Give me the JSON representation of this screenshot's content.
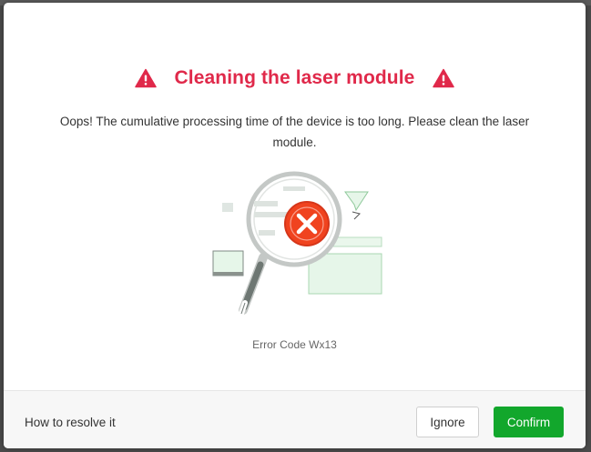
{
  "dialog": {
    "title": "Cleaning the laser module",
    "message": "Oops! The cumulative processing time of the device is too long. Please clean the laser module.",
    "error_code": "Error Code Wx13",
    "title_icon": "warning-triangle-icon",
    "illustration_icon": "magnifier-error-icon"
  },
  "footer": {
    "resolve_link": "How to resolve it",
    "ignore_label": "Ignore",
    "confirm_label": "Confirm"
  },
  "colors": {
    "title": "#e0294a",
    "confirm": "#12a72c",
    "error_badge": "#f0431f"
  }
}
